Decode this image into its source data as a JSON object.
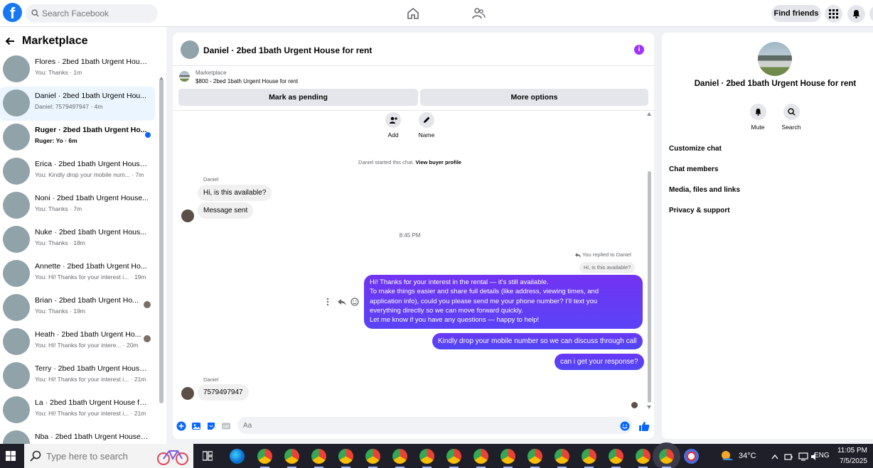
{
  "header": {
    "logo": "f",
    "search_placeholder": "Search Facebook",
    "find_friends": "Find friends",
    "icons": [
      "home-icon",
      "friends-icon",
      "menu-grid-icon",
      "bell-icon"
    ]
  },
  "sidebar": {
    "title": "Marketplace",
    "conversations": [
      {
        "title": "Flores · 2bed 1bath Urgent Hous...",
        "preview": "You: Thanks · 1m"
      },
      {
        "title": "Daniel · 2bed 1bath Urgent Hou...",
        "preview": "Daniel: 7579497947 · 4m"
      },
      {
        "title": "Ruger · 2bed 1bath Urgent Ho...",
        "preview": "Ruger: Yo · 6m"
      },
      {
        "title": "Erica · 2bed 1bath Urgent House...",
        "preview": "You: Kindly drop your mobile num... · 7m"
      },
      {
        "title": "Noni · 2bed 1bath Urgent House...",
        "preview": "You: Thanks · 7m"
      },
      {
        "title": "Nuke · 2bed 1bath Urgent Hous...",
        "preview": "You: Thanks · 18m"
      },
      {
        "title": "Annette · 2bed 1bath Urgent Ho...",
        "preview": "You: Hi! Thanks for your interest i... · 19m"
      },
      {
        "title": "Brian · 2bed 1bath Urgent Ho...",
        "preview": "You: Thanks · 19m"
      },
      {
        "title": "Heath · 2bed 1bath Urgent Ho...",
        "preview": "You: Hi! Thanks for your intere... · 20m"
      },
      {
        "title": "Terry · 2bed 1bath Urgent House...",
        "preview": "You: Hi! Thanks for your interest i... · 21m"
      },
      {
        "title": "La · 2bed 1bath Urgent House fo...",
        "preview": "You: Hi! Thanks for your interest i... · 21m"
      },
      {
        "title": "Nba · 2bed 1bath Urgent House ...",
        "preview": ""
      }
    ]
  },
  "chat": {
    "title": "Daniel · 2bed 1bath Urgent House for rent",
    "listing_source": "Marketplace",
    "listing_price": "$800 - 2bed 1bath Urgent House for rent",
    "mark_pending": "Mark as pending",
    "more_options": "More options",
    "quick_add": "Add",
    "quick_name": "Name",
    "started_text": "Daniel started this chat.",
    "view_profile": "View buyer profile",
    "sender1": "Daniel",
    "msg1": "Hi, is this available?",
    "msg2": "Message sent",
    "time_sep": "8:45 PM",
    "reply_note": "You replied to Daniel",
    "reply_quote": "Hi, is this available?",
    "long_reply": [
      "Hi! Thanks for your interest in the rental — it’s still available.",
      "To make things easier and share full details (like address, viewing times, and",
      "application info), could you please send me your phone number? I’ll text you",
      "everything directly so we can move forward quickly.",
      "Let me know if you have any questions — happy to help!"
    ],
    "out_msg2": "Kindly drop your mobile number so we can discuss through call",
    "out_msg3": "can i get your response?",
    "sender2": "Daniel",
    "msg_last": "7579497947",
    "composer_placeholder": "Aa"
  },
  "info": {
    "title": "Daniel · 2bed 1bath Urgent House for rent",
    "mute": "Mute",
    "search": "Search",
    "items": [
      "Customize chat",
      "Chat members",
      "Media, files and links",
      "Privacy & support"
    ]
  },
  "taskbar": {
    "search_placeholder": "Type here to search",
    "temp": "34°C",
    "lang": "ENG",
    "time": "11:05 PM",
    "date": "7/5/2025"
  },
  "colors": {
    "accent": "#0866ff",
    "outgoing_bubble": "#5a3cf7",
    "info_icon": "#a033ff"
  }
}
